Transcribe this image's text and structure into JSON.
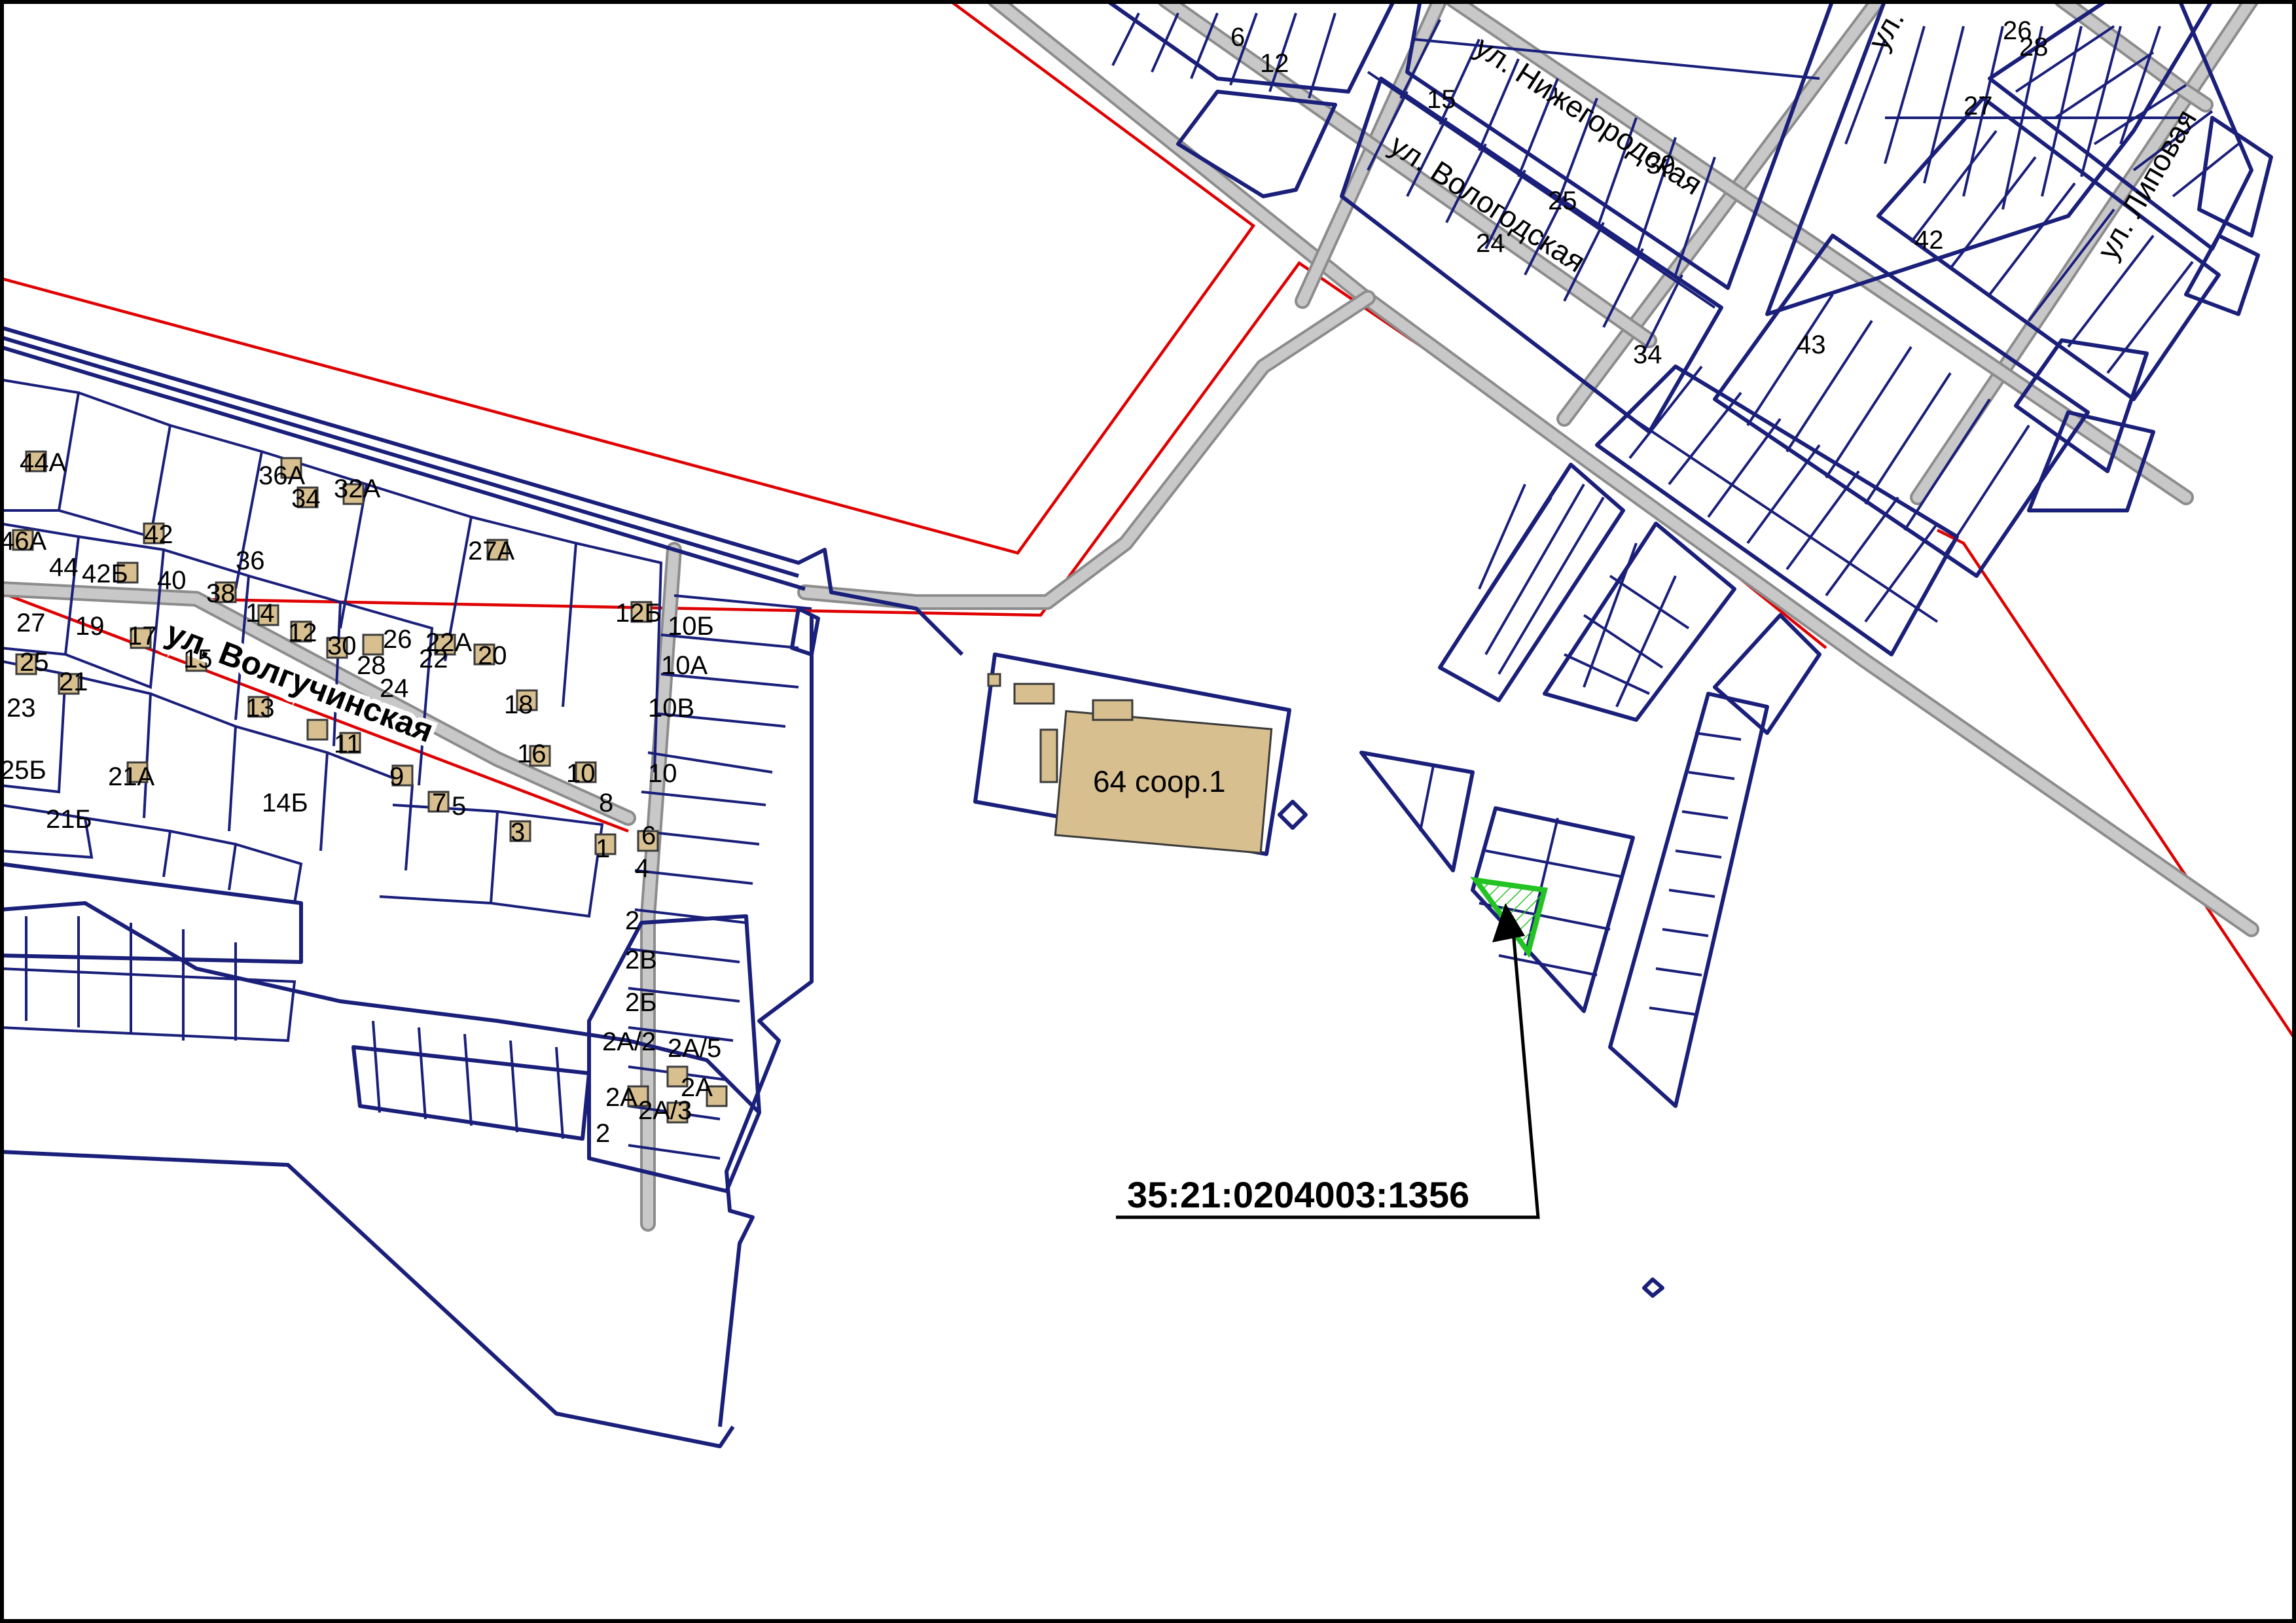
{
  "map": {
    "colors": {
      "parcel_outline": "#1a1f7a",
      "road_fill": "#c8c8c8",
      "zone_line": "#e00000",
      "building_fill": "#d7bf8f",
      "highlight_parcel": "#22c322",
      "background": "#ffffff"
    },
    "highlight": {
      "cadastral_number": "35:21:0204003:1356"
    },
    "streets": {
      "volguchinskaya": "ул. Волгучинская",
      "nizhegorodskaya": "ул. Нижегородская",
      "vologodskaya": "ул. Вологодская",
      "lipovaya": "ул. Липовая",
      "top_partial": "ул."
    },
    "structure_label": "64 соор.1",
    "lot_labels": {
      "l44a": "44А",
      "l36a": "36А",
      "l34": "34",
      "l32a": "32А",
      "l46a": "46А",
      "l44": "44",
      "l42b": "42Б",
      "l42": "42",
      "l40": "40",
      "l38": "38",
      "l36": "36",
      "l27": "27",
      "l25": "25",
      "l23": "23",
      "l25b": "25Б",
      "l21b": "21Б",
      "l21": "21",
      "l19": "19",
      "l17": "17",
      "l15": "15",
      "l21a": "21А",
      "l14": "14",
      "l13": "13",
      "l14b": "14Б",
      "l12": "12",
      "l11": "11",
      "l10": "10",
      "l9": "9",
      "l8": "8",
      "l7": "7",
      "l6": "6",
      "l5": "5",
      "l4": "4",
      "l3": "3",
      "l2": "2",
      "l1": "1",
      "l12b": "12Б",
      "l22": "22",
      "l22a": "22А",
      "l20": "20",
      "l18": "18",
      "l16": "16",
      "l26": "26",
      "l24": "24",
      "l28": "28",
      "l30": "30",
      "l27a": "27А",
      "l10b": "10Б",
      "l10a": "10А",
      "l10v": "10В",
      "l10c": "10",
      "l2v": "2В",
      "l2b": "2Б",
      "l2a": "2А",
      "l2a5": "2А/5",
      "l2a2": "2А/2",
      "l2a3": "2А/3",
      "l2a4": "2А",
      "l2a1": "2А",
      "l2d": "2",
      "n6": "6",
      "n12": "12",
      "n15": "15",
      "n25": "25",
      "n30": "30",
      "n24": "24",
      "n34": "34",
      "n43": "43",
      "n42": "42",
      "n27": "27",
      "n26": "26",
      "n28": "28"
    }
  }
}
